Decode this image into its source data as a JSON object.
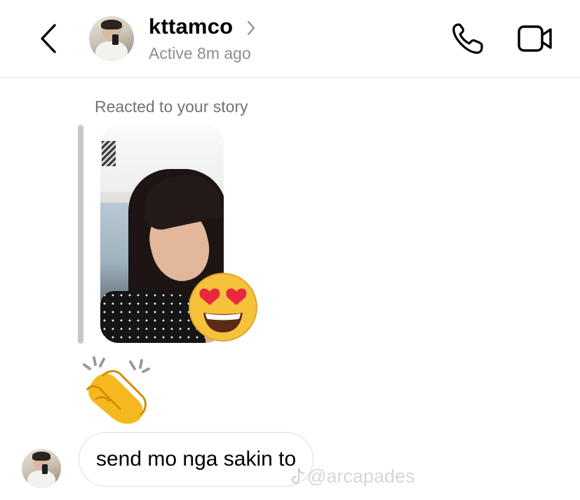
{
  "header": {
    "username": "kttamco",
    "status": "Active 8m ago",
    "icons": {
      "back": "chevron-left-icon",
      "profile_chevron": "chevron-right-icon",
      "call": "phone-icon",
      "video": "video-camera-icon"
    }
  },
  "thread": {
    "story_label": "Reacted to your story",
    "story_reaction": "heart-eyes-emoji",
    "emoji_message": "clapping-hands-emoji",
    "text_message": "send mo nga sakin to"
  },
  "watermark": {
    "handle": "@arcapades",
    "icon": "tiktok-icon"
  },
  "colors": {
    "secondary_text": "#8e8e8e",
    "bubble_border": "#dbdbdb",
    "story_bar": "#c7c7c7"
  }
}
